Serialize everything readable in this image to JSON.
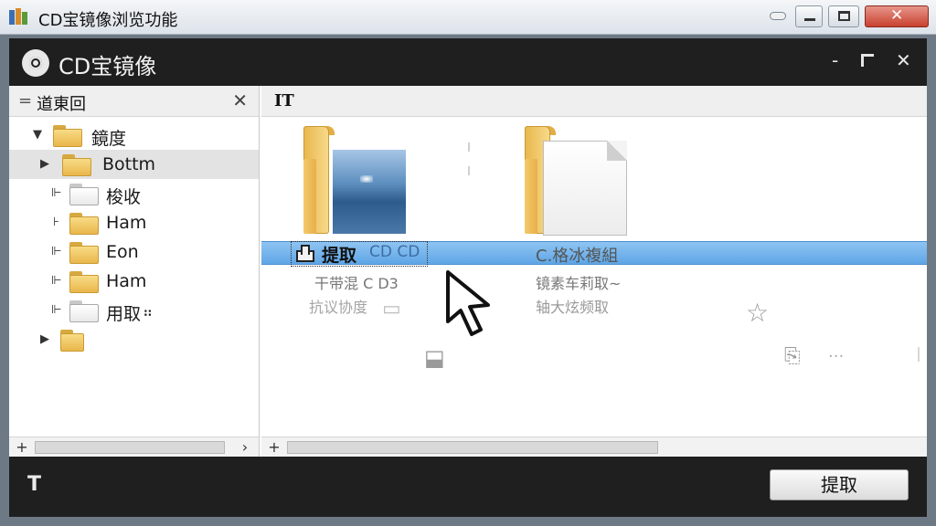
{
  "window": {
    "title": "CD宝镜像浏览功能",
    "min_glyph": "—",
    "max_glyph": "▢",
    "close_glyph": "✕"
  },
  "header": {
    "title": "CD宝镜像",
    "minimize_glyph": "-",
    "restore_glyph": "⌜",
    "close_glyph": "✕"
  },
  "left_pane": {
    "title": "道東回",
    "menu_glyph": "=",
    "close_glyph": "✕",
    "tree": [
      {
        "label": "鏡度",
        "expander": "▼",
        "folder": "yellow",
        "indent": 0
      },
      {
        "label": "Bottm",
        "expander": "▶",
        "folder": "yellow",
        "indent": 1,
        "selected": true
      },
      {
        "label": "梭收",
        "expander": "⊩",
        "folder": "white",
        "indent": 2
      },
      {
        "label": "Ham",
        "expander": "⊦",
        "folder": "yellow",
        "indent": 2
      },
      {
        "label": "Eon",
        "expander": "⊩",
        "folder": "yellow",
        "indent": 2
      },
      {
        "label": "Ham",
        "expander": "⊩",
        "folder": "yellow",
        "indent": 2
      },
      {
        "label": "用取",
        "expander": "⊩",
        "folder": "white",
        "indent": 2,
        "suffix": "⠶"
      },
      {
        "label": "",
        "expander": "▶",
        "folder": "yellow",
        "indent": 1
      }
    ],
    "scroll_left": "+",
    "scroll_right": "›"
  },
  "right_pane": {
    "title": "IT",
    "items": [
      {
        "title": "提取",
        "title_suffix": "CD CD",
        "line1": "干带混 C D3",
        "line2": "抗议协度"
      },
      {
        "title": "C.格冰複組",
        "line1": "镜素车莉取~",
        "line2": "轴大炫频取"
      }
    ],
    "scroll_left": "+"
  },
  "footer": {
    "icon_glyph": "T",
    "extract_label": "提取"
  }
}
